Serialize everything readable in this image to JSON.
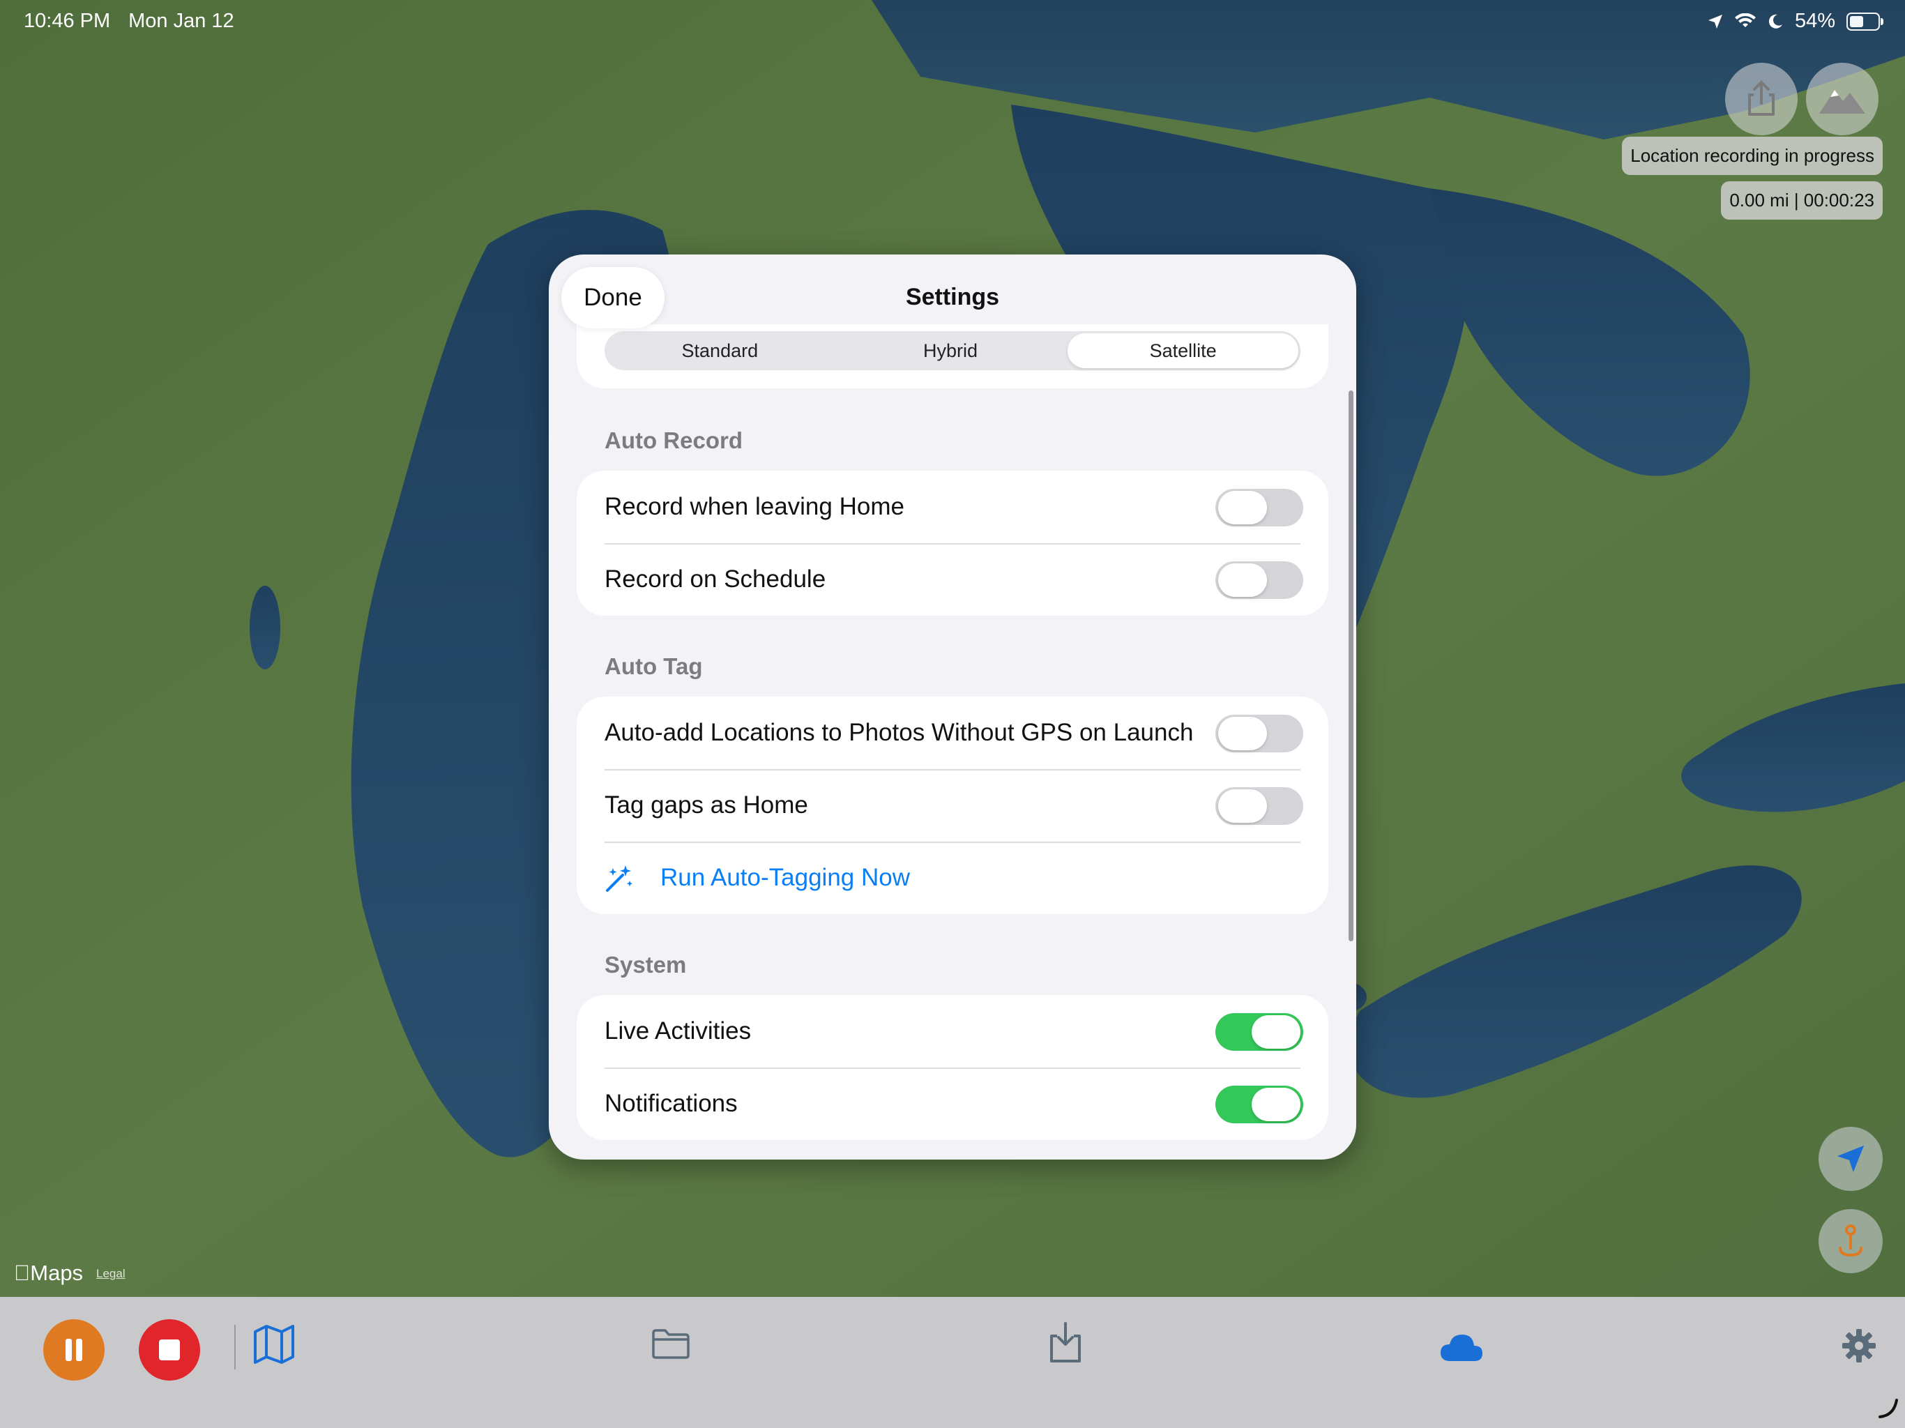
{
  "status_bar": {
    "time": "10:46 PM",
    "date": "Mon Jan 12",
    "battery": "54%",
    "battery_level": 0.54,
    "icons": [
      "location-arrow-icon",
      "wifi-icon",
      "moon-icon",
      "battery-icon"
    ]
  },
  "overlay": {
    "recording_status": "Location recording in progress",
    "recording_stats": "0.00 mi | 00:00:23",
    "buttons": [
      "share-icon",
      "map-mode-icon"
    ]
  },
  "settings": {
    "done_label": "Done",
    "title": "Settings",
    "map_types": [
      "Standard",
      "Hybrid",
      "Satellite"
    ],
    "selected_map_type": "Satellite",
    "sections": {
      "auto_record": {
        "header": "Auto Record",
        "rows": [
          {
            "label": "Record when leaving Home",
            "on": false
          },
          {
            "label": "Record on Schedule",
            "on": false
          }
        ]
      },
      "auto_tag": {
        "header": "Auto Tag",
        "rows": [
          {
            "label": "Auto-add Locations to Photos Without GPS on Launch",
            "on": false
          },
          {
            "label": "Tag gaps as Home",
            "on": false
          }
        ],
        "action_label": "Run Auto-Tagging Now"
      },
      "system": {
        "header": "System",
        "rows": [
          {
            "label": "Live Activities",
            "on": true
          },
          {
            "label": "Notifications",
            "on": true
          }
        ]
      }
    }
  },
  "attribution": {
    "maps": "Maps",
    "legal": "Legal"
  },
  "colors": {
    "accent_blue": "#0a7ff5",
    "toggle_on": "#34c759",
    "pause_orange": "#e07a22",
    "stop_red": "#e0262b"
  },
  "tab_bar": {
    "items": [
      "pause-icon",
      "stop-icon",
      "map-icon",
      "folder-icon",
      "import-icon",
      "cloud-icon",
      "gear-icon"
    ]
  }
}
